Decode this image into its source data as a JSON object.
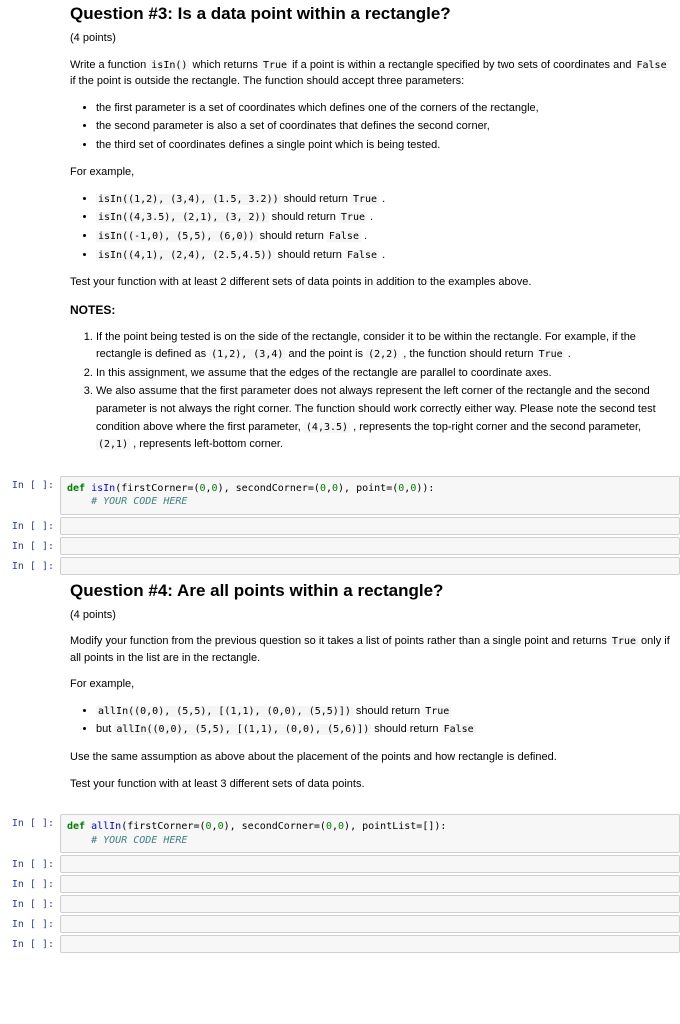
{
  "q3": {
    "title": "Question #3: Is a data point within a rectangle?",
    "points": "(4 points)",
    "intro_a": "Write a function ",
    "intro_fn": "isIn()",
    "intro_b": " which returns ",
    "intro_true": "True",
    "intro_c": " if a point is within a rectangle specified by two sets of coordinates and ",
    "intro_false": "False",
    "intro_d": " if the point is outside the rectangle. The function should accept three parameters:",
    "b1": "the first parameter is a set of coordinates which defines one of the corners of the rectangle,",
    "b2": "the second parameter is also a set of coordinates that defines the second corner,",
    "b3": "the third set of coordinates defines a single point which is being tested.",
    "forex": "For example,",
    "ex1_code": "isIn((1,2), (3,4), (1.5, 3.2))",
    "ex1_txt": " should return ",
    "ex1_val": "True",
    "ex2_code": "isIn((4,3.5), (2,1), (3, 2))",
    "ex2_txt": " should return ",
    "ex2_val": "True",
    "ex3_code": "isIn((-1,0), (5,5), (6,0))",
    "ex3_txt": " should return ",
    "ex3_val": "False",
    "ex4_code": "isIn((4,1), (2,4), (2.5,4.5))",
    "ex4_txt": " should return ",
    "ex4_val": "False",
    "test_txt": "Test your function with at least 2 different sets of data points in addition to the examples above.",
    "notes_h": "NOTES:",
    "n1_a": "If the point being tested is on the side of the rectangle, consider it to be within the rectangle. For example, if the rectangle is defined as ",
    "n1_c1": "(1,2), (3,4)",
    "n1_b": " and the point is ",
    "n1_c2": "(2,2)",
    "n1_c": " , the function should return ",
    "n1_val": "True",
    "n2": "In this assignment, we assume that the edges of the rectangle are parallel to coordinate axes.",
    "n3_a": "We also assume that the first parameter does not always represent the left corner of the rectangle and the second parameter is not always the right corner. The function should work correctly either way. Please note the second test condition above where the first parameter, ",
    "n3_c1": "(4,3.5)",
    "n3_b": " , represents the top-right corner and the second parameter, ",
    "n3_c2": "(2,1)",
    "n3_c": " , represents left-bottom corner."
  },
  "code3": {
    "kw_def": "def",
    "fn": "isIn",
    "sig": "(firstCorner=(",
    "z1": "0",
    "c1": ",",
    "z2": "0",
    "p1": "), secondCorner=(",
    "z3": "0",
    "c2": ",",
    "z4": "0",
    "p2": "), point=(",
    "z5": "0",
    "c3": ",",
    "z6": "0",
    "end": ")):",
    "comment": "    # YOUR CODE HERE"
  },
  "q4": {
    "title": "Question #4: Are all points within a rectangle?",
    "points": "(4 points)",
    "intro_a": "Modify your function from the previous question so it takes a list of points rather than a single point and returns ",
    "intro_true": "True",
    "intro_b": " only if all points in the list are in the rectangle.",
    "forex": "For example,",
    "ex1_code": "allIn((0,0), (5,5), [(1,1), (0,0), (5,5)])",
    "ex1_txt": " should return ",
    "ex1_val": "True",
    "ex2_pre": "but ",
    "ex2_code": "allIn((0,0), (5,5), [(1,1), (0,0), (5,6)])",
    "ex2_txt": " should return ",
    "ex2_val": "False",
    "assume": "Use the same assumption as above about the placement of the points and how rectangle is defined.",
    "test_txt": "Test your function with at least 3 different sets of data points."
  },
  "code4": {
    "kw_def": "def",
    "fn": "allIn",
    "sig": "(firstCorner=(",
    "z1": "0",
    "c1": ",",
    "z2": "0",
    "p1": "), secondCorner=(",
    "z3": "0",
    "c2": ",",
    "z4": "0",
    "p2": "), pointList=[]):",
    "comment": "    # YOUR CODE HERE"
  },
  "prompt_label": "In [ ]:"
}
